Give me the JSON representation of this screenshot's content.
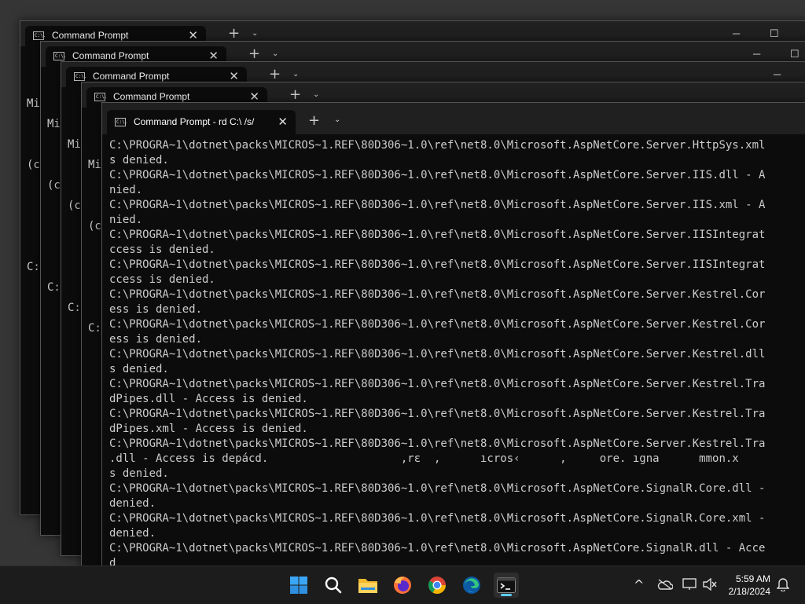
{
  "windows": {
    "back_tab_label": "Command Prompt",
    "back_lines": [
      "Mi",
      "(c",
      "",
      "C:"
    ],
    "front_tab_label": "Command Prompt - rd  C:\\ /s/"
  },
  "icons": {
    "cmd_glyph": "C:\\.",
    "close": "✕",
    "new_tab": "+",
    "dropdown": "⌄",
    "minimize": "─",
    "maximize": "☐"
  },
  "console_lines": [
    "C:\\PROGRA~1\\dotnet\\packs\\MICROS~1.REF\\80D306~1.0\\ref\\net8.0\\Microsoft.AspNetCore.Server.HttpSys.xml",
    "s denied.",
    "C:\\PROGRA~1\\dotnet\\packs\\MICROS~1.REF\\80D306~1.0\\ref\\net8.0\\Microsoft.AspNetCore.Server.IIS.dll - A",
    "nied.",
    "C:\\PROGRA~1\\dotnet\\packs\\MICROS~1.REF\\80D306~1.0\\ref\\net8.0\\Microsoft.AspNetCore.Server.IIS.xml - A",
    "nied.",
    "C:\\PROGRA~1\\dotnet\\packs\\MICROS~1.REF\\80D306~1.0\\ref\\net8.0\\Microsoft.AspNetCore.Server.IISIntegrat",
    "ccess is denied.",
    "C:\\PROGRA~1\\dotnet\\packs\\MICROS~1.REF\\80D306~1.0\\ref\\net8.0\\Microsoft.AspNetCore.Server.IISIntegrat",
    "ccess is denied.",
    "C:\\PROGRA~1\\dotnet\\packs\\MICROS~1.REF\\80D306~1.0\\ref\\net8.0\\Microsoft.AspNetCore.Server.Kestrel.Cor",
    "ess is denied.",
    "C:\\PROGRA~1\\dotnet\\packs\\MICROS~1.REF\\80D306~1.0\\ref\\net8.0\\Microsoft.AspNetCore.Server.Kestrel.Cor",
    "ess is denied.",
    "C:\\PROGRA~1\\dotnet\\packs\\MICROS~1.REF\\80D306~1.0\\ref\\net8.0\\Microsoft.AspNetCore.Server.Kestrel.dll",
    "s denied.",
    "C:\\PROGRA~1\\dotnet\\packs\\MICROS~1.REF\\80D306~1.0\\ref\\net8.0\\Microsoft.AspNetCore.Server.Kestrel.Tra",
    "dPipes.dll - Access is denied.",
    "C:\\PROGRA~1\\dotnet\\packs\\MICROS~1.REF\\80D306~1.0\\ref\\net8.0\\Microsoft.AspNetCore.Server.Kestrel.Tra",
    "dPipes.xml - Access is denied.",
    "C:\\PROGRA~1\\dotnet\\packs\\MICROS~1.REF\\80D306~1.0\\ref\\net8.0\\Microsoft.AspNetCore.Server.Kestrel.Tra",
    ".dll - Access is depácd.                    ,rε  ,      ıcros‹      ,     ore. ıgna      mmon.x",
    "s denied.",
    "C:\\PROGRA~1\\dotnet\\packs\\MICROS~1.REF\\80D306~1.0\\ref\\net8.0\\Microsoft.AspNetCore.SignalR.Core.dll -",
    "denied.",
    "C:\\PROGRA~1\\dotnet\\packs\\MICROS~1.REF\\80D306~1.0\\ref\\net8.0\\Microsoft.AspNetCore.SignalR.Core.xml -",
    "denied.",
    "C:\\PROGRA~1\\dotnet\\packs\\MICROS~1.REF\\80D306~1.0\\ref\\net8.0\\Microsoft.AspNetCore.SignalR.dll - Acce",
    "d"
  ],
  "taskbar": {
    "apps": [
      "start-icon",
      "search-icon",
      "file-explorer-icon",
      "firefox-icon",
      "chrome-icon",
      "edge-icon",
      "terminal-icon"
    ],
    "tray": {
      "chevron": "^",
      "time": "5:59 AM",
      "date": "2/18/2024"
    }
  },
  "colors": {
    "console_bg": "#0c0c0c",
    "console_text": "#cccccc",
    "taskbar_bg": "#1c1c1c",
    "accent": "#60cdff"
  }
}
